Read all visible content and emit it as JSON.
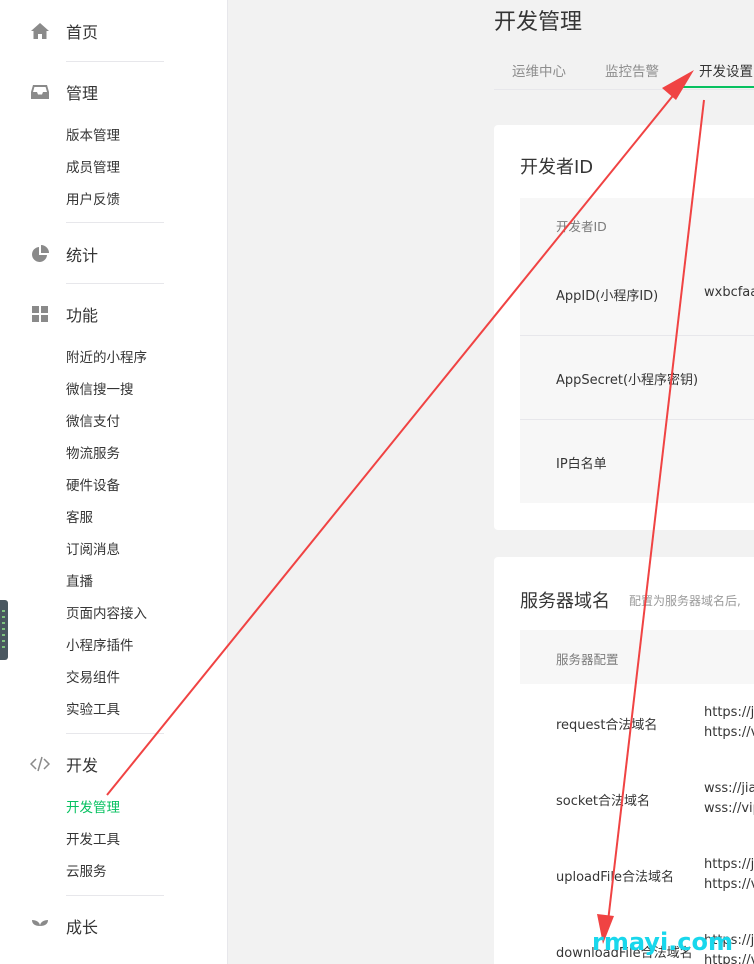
{
  "sidebar": {
    "home": "首页",
    "manage": "管理",
    "manage_items": [
      "版本管理",
      "成员管理",
      "用户反馈"
    ],
    "stats": "统计",
    "features": "功能",
    "feature_items": [
      "附近的小程序",
      "微信搜一搜",
      "微信支付",
      "物流服务",
      "硬件设备",
      "客服",
      "订阅消息",
      "直播",
      "页面内容接入",
      "小程序插件",
      "交易组件",
      "实验工具"
    ],
    "dev": "开发",
    "dev_items": [
      "开发管理",
      "开发工具",
      "云服务"
    ],
    "grow": "成长"
  },
  "page_title": "开发管理",
  "tabs": [
    "运维中心",
    "监控告警",
    "开发设置"
  ],
  "dev_id": {
    "title": "开发者ID",
    "header": "开发者ID",
    "rows": [
      {
        "label": "AppID(小程序ID)",
        "value": "wxbcfaa"
      },
      {
        "label": "AppSecret(小程序密钥)",
        "value": ""
      },
      {
        "label": "IP白名单",
        "value": ""
      }
    ]
  },
  "server": {
    "title": "服务器域名",
    "desc": "配置为服务器域名后,",
    "header": "服务器配置",
    "rows": [
      {
        "label": "request合法域名",
        "value1": "https://ji",
        "value2": "https://v"
      },
      {
        "label": "socket合法域名",
        "value1": "wss://jia",
        "value2": "wss://vip"
      },
      {
        "label": "uploadFile合法域名",
        "value1": "https://ji",
        "value2": "https://v"
      },
      {
        "label": "downloadFile合法域名",
        "value1": "https://ji",
        "value2": "https://v"
      }
    ]
  },
  "watermark": "rmayi.com",
  "colors": {
    "accent": "#07c160",
    "annotation": "#f04343",
    "watermark": "#19d7ec"
  }
}
